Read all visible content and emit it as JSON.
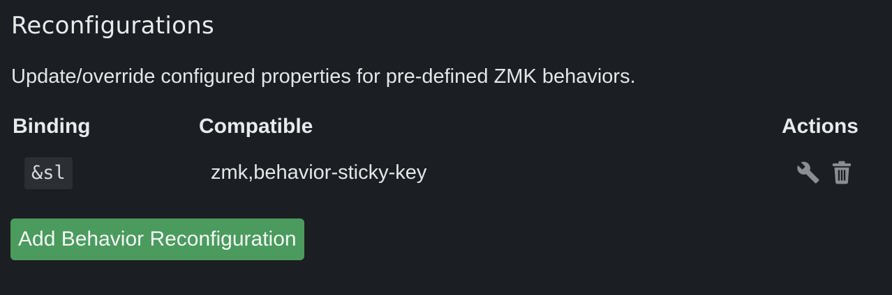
{
  "section": {
    "title": "Reconfigurations",
    "description": "Update/override configured properties for pre-defined ZMK behaviors."
  },
  "table": {
    "headers": {
      "binding": "Binding",
      "compatible": "Compatible",
      "actions": "Actions"
    },
    "rows": [
      {
        "binding": "&sl",
        "compatible": "zmk,behavior-sticky-key",
        "actions": [
          "wrench-icon",
          "trash-icon"
        ]
      }
    ]
  },
  "buttons": {
    "add_label": "Add Behavior Reconfiguration"
  },
  "colors": {
    "background": "#1b1e22",
    "accent_green": "#4a9b5d",
    "icon_gray": "#8a8f95",
    "code_background": "#2b2f34"
  }
}
